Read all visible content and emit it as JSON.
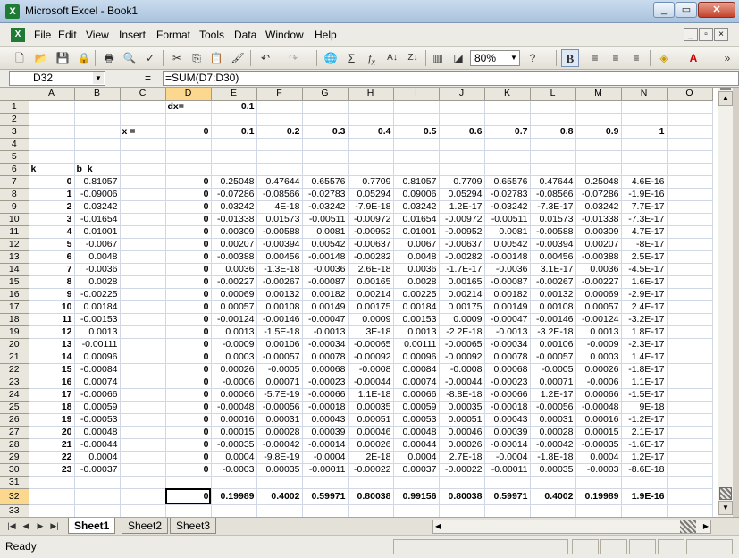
{
  "window": {
    "title": "Microsoft Excel - Book1",
    "app_letter": "X"
  },
  "menu": {
    "items": [
      "File",
      "Edit",
      "View",
      "Insert",
      "Format",
      "Tools",
      "Data",
      "Window",
      "Help"
    ],
    "mdi_buttons": [
      "_",
      "▫",
      "×"
    ]
  },
  "toolbar": {
    "zoom": "80%",
    "bold_label": "B"
  },
  "formula_bar": {
    "name_box": "D32",
    "equals": "=",
    "formula": "=SUM(D7:D30)"
  },
  "sheet": {
    "columns": [
      "A",
      "B",
      "C",
      "D",
      "E",
      "F",
      "G",
      "H",
      "I",
      "J",
      "K",
      "L",
      "M",
      "N",
      "O"
    ],
    "selected_cell": "D32",
    "rows": [
      {
        "n": "1",
        "cells": [
          "",
          "",
          "",
          "dx=",
          "0.1",
          "",
          "",
          "",
          "",
          "",
          "",
          "",
          "",
          "",
          ""
        ]
      },
      {
        "n": "2",
        "cells": [
          "",
          "",
          "",
          "",
          "",
          "",
          "",
          "",
          "",
          "",
          "",
          "",
          "",
          "",
          ""
        ]
      },
      {
        "n": "3",
        "cells": [
          "",
          "",
          "x =",
          "0",
          "0.1",
          "0.2",
          "0.3",
          "0.4",
          "0.5",
          "0.6",
          "0.7",
          "0.8",
          "0.9",
          "1",
          ""
        ]
      },
      {
        "n": "4",
        "cells": [
          "",
          "",
          "",
          "",
          "",
          "",
          "",
          "",
          "",
          "",
          "",
          "",
          "",
          "",
          ""
        ]
      },
      {
        "n": "5",
        "cells": [
          "",
          "",
          "",
          "",
          "",
          "",
          "",
          "",
          "",
          "",
          "",
          "",
          "",
          "",
          ""
        ]
      },
      {
        "n": "6",
        "cells": [
          "k",
          "b_k",
          "",
          "",
          "",
          "",
          "",
          "",
          "",
          "",
          "",
          "",
          "",
          "",
          ""
        ]
      },
      {
        "n": "7",
        "cells": [
          "0",
          "0.81057",
          "",
          "0",
          "0.25048",
          "0.47644",
          "0.65576",
          "0.7709",
          "0.81057",
          "0.7709",
          "0.65576",
          "0.47644",
          "0.25048",
          "4.6E-16",
          ""
        ]
      },
      {
        "n": "8",
        "cells": [
          "1",
          "-0.09006",
          "",
          "0",
          "-0.07286",
          "-0.08566",
          "-0.02783",
          "0.05294",
          "0.09006",
          "0.05294",
          "-0.02783",
          "-0.08566",
          "-0.07286",
          "-1.9E-16",
          ""
        ]
      },
      {
        "n": "9",
        "cells": [
          "2",
          "0.03242",
          "",
          "0",
          "0.03242",
          "4E-18",
          "-0.03242",
          "-7.9E-18",
          "0.03242",
          "1.2E-17",
          "-0.03242",
          "-7.3E-17",
          "0.03242",
          "7.7E-17",
          ""
        ]
      },
      {
        "n": "10",
        "cells": [
          "3",
          "-0.01654",
          "",
          "0",
          "-0.01338",
          "0.01573",
          "-0.00511",
          "-0.00972",
          "0.01654",
          "-0.00972",
          "-0.00511",
          "0.01573",
          "-0.01338",
          "-7.3E-17",
          ""
        ]
      },
      {
        "n": "11",
        "cells": [
          "4",
          "0.01001",
          "",
          "0",
          "0.00309",
          "-0.00588",
          "0.0081",
          "-0.00952",
          "0.01001",
          "-0.00952",
          "0.0081",
          "-0.00588",
          "0.00309",
          "4.7E-17",
          ""
        ]
      },
      {
        "n": "12",
        "cells": [
          "5",
          "-0.0067",
          "",
          "0",
          "0.00207",
          "-0.00394",
          "0.00542",
          "-0.00637",
          "0.0067",
          "-0.00637",
          "0.00542",
          "-0.00394",
          "0.00207",
          "-8E-17",
          ""
        ]
      },
      {
        "n": "13",
        "cells": [
          "6",
          "0.0048",
          "",
          "0",
          "-0.00388",
          "0.00456",
          "-0.00148",
          "-0.00282",
          "0.0048",
          "-0.00282",
          "-0.00148",
          "0.00456",
          "-0.00388",
          "2.5E-17",
          ""
        ]
      },
      {
        "n": "14",
        "cells": [
          "7",
          "-0.0036",
          "",
          "0",
          "0.0036",
          "-1.3E-18",
          "-0.0036",
          "2.6E-18",
          "0.0036",
          "-1.7E-17",
          "-0.0036",
          "3.1E-17",
          "0.0036",
          "-4.5E-17",
          ""
        ]
      },
      {
        "n": "15",
        "cells": [
          "8",
          "0.0028",
          "",
          "0",
          "-0.00227",
          "-0.00267",
          "-0.00087",
          "0.00165",
          "0.0028",
          "0.00165",
          "-0.00087",
          "-0.00267",
          "-0.00227",
          "1.6E-17",
          ""
        ]
      },
      {
        "n": "16",
        "cells": [
          "9",
          "-0.00225",
          "",
          "0",
          "0.00069",
          "0.00132",
          "0.00182",
          "0.00214",
          "0.00225",
          "0.00214",
          "0.00182",
          "0.00132",
          "0.00069",
          "-2.9E-17",
          ""
        ]
      },
      {
        "n": "17",
        "cells": [
          "10",
          "0.00184",
          "",
          "0",
          "0.00057",
          "0.00108",
          "0.00149",
          "0.00175",
          "0.00184",
          "0.00175",
          "0.00149",
          "0.00108",
          "0.00057",
          "2.4E-17",
          ""
        ]
      },
      {
        "n": "18",
        "cells": [
          "11",
          "-0.00153",
          "",
          "0",
          "-0.00124",
          "-0.00146",
          "-0.00047",
          "0.0009",
          "0.00153",
          "0.0009",
          "-0.00047",
          "-0.00146",
          "-0.00124",
          "-3.2E-17",
          ""
        ]
      },
      {
        "n": "19",
        "cells": [
          "12",
          "0.0013",
          "",
          "0",
          "0.0013",
          "-1.5E-18",
          "-0.0013",
          "3E-18",
          "0.0013",
          "-2.2E-18",
          "-0.0013",
          "-3.2E-18",
          "0.0013",
          "1.8E-17",
          ""
        ]
      },
      {
        "n": "20",
        "cells": [
          "13",
          "-0.00111",
          "",
          "0",
          "-0.0009",
          "0.00106",
          "-0.00034",
          "-0.00065",
          "0.00111",
          "-0.00065",
          "-0.00034",
          "0.00106",
          "-0.0009",
          "-2.3E-17",
          ""
        ]
      },
      {
        "n": "21",
        "cells": [
          "14",
          "0.00096",
          "",
          "0",
          "0.0003",
          "-0.00057",
          "0.00078",
          "-0.00092",
          "0.00096",
          "-0.00092",
          "0.00078",
          "-0.00057",
          "0.0003",
          "1.4E-17",
          ""
        ]
      },
      {
        "n": "22",
        "cells": [
          "15",
          "-0.00084",
          "",
          "0",
          "0.00026",
          "-0.0005",
          "0.00068",
          "-0.0008",
          "0.00084",
          "-0.0008",
          "0.00068",
          "-0.0005",
          "0.00026",
          "-1.8E-17",
          ""
        ]
      },
      {
        "n": "23",
        "cells": [
          "16",
          "0.00074",
          "",
          "0",
          "-0.0006",
          "0.00071",
          "-0.00023",
          "-0.00044",
          "0.00074",
          "-0.00044",
          "-0.00023",
          "0.00071",
          "-0.0006",
          "1.1E-17",
          ""
        ]
      },
      {
        "n": "24",
        "cells": [
          "17",
          "-0.00066",
          "",
          "0",
          "0.00066",
          "-5.7E-19",
          "-0.00066",
          "1.1E-18",
          "0.00066",
          "-8.8E-18",
          "-0.00066",
          "1.2E-17",
          "0.00066",
          "-1.5E-17",
          ""
        ]
      },
      {
        "n": "25",
        "cells": [
          "18",
          "0.00059",
          "",
          "0",
          "-0.00048",
          "-0.00056",
          "-0.00018",
          "0.00035",
          "0.00059",
          "0.00035",
          "-0.00018",
          "-0.00056",
          "-0.00048",
          "9E-18",
          ""
        ]
      },
      {
        "n": "26",
        "cells": [
          "19",
          "-0.00053",
          "",
          "0",
          "0.00016",
          "0.00031",
          "0.00043",
          "0.00051",
          "0.00053",
          "0.00051",
          "0.00043",
          "0.00031",
          "0.00016",
          "-1.2E-17",
          ""
        ]
      },
      {
        "n": "27",
        "cells": [
          "20",
          "0.00048",
          "",
          "0",
          "0.00015",
          "0.00028",
          "0.00039",
          "0.00046",
          "0.00048",
          "0.00046",
          "0.00039",
          "0.00028",
          "0.00015",
          "2.1E-17",
          ""
        ]
      },
      {
        "n": "28",
        "cells": [
          "21",
          "-0.00044",
          "",
          "0",
          "-0.00035",
          "-0.00042",
          "-0.00014",
          "0.00026",
          "0.00044",
          "0.00026",
          "-0.00014",
          "-0.00042",
          "-0.00035",
          "-1.6E-17",
          ""
        ]
      },
      {
        "n": "29",
        "cells": [
          "22",
          "0.0004",
          "",
          "0",
          "0.0004",
          "-9.8E-19",
          "-0.0004",
          "2E-18",
          "0.0004",
          "2.7E-18",
          "-0.0004",
          "-1.8E-18",
          "0.0004",
          "1.2E-17",
          ""
        ]
      },
      {
        "n": "30",
        "cells": [
          "23",
          "-0.00037",
          "",
          "0",
          "-0.0003",
          "0.00035",
          "-0.00011",
          "-0.00022",
          "0.00037",
          "-0.00022",
          "-0.00011",
          "0.00035",
          "-0.0003",
          "-8.6E-18",
          ""
        ]
      },
      {
        "n": "31",
        "cells": [
          "",
          "",
          "",
          "",
          "",
          "",
          "",
          "",
          "",
          "",
          "",
          "",
          "",
          "",
          ""
        ]
      },
      {
        "n": "32",
        "cells": [
          "",
          "",
          "",
          "0",
          "0.19989",
          "0.4002",
          "0.59971",
          "0.80038",
          "0.99156",
          "0.80038",
          "0.59971",
          "0.4002",
          "0.19989",
          "1.9E-16",
          ""
        ]
      },
      {
        "n": "33",
        "cells": [
          "",
          "",
          "",
          "",
          "",
          "",
          "",
          "",
          "",
          "",
          "",
          "",
          "",
          "",
          ""
        ]
      },
      {
        "n": "34",
        "cells": [
          "",
          "",
          "",
          "",
          "",
          "",
          "",
          "",
          "",
          "",
          "",
          "",
          "",
          "",
          ""
        ]
      }
    ]
  },
  "tabs": {
    "items": [
      "Sheet1",
      "Sheet2",
      "Sheet3"
    ],
    "active": "Sheet1"
  },
  "status": {
    "text": "Ready"
  }
}
